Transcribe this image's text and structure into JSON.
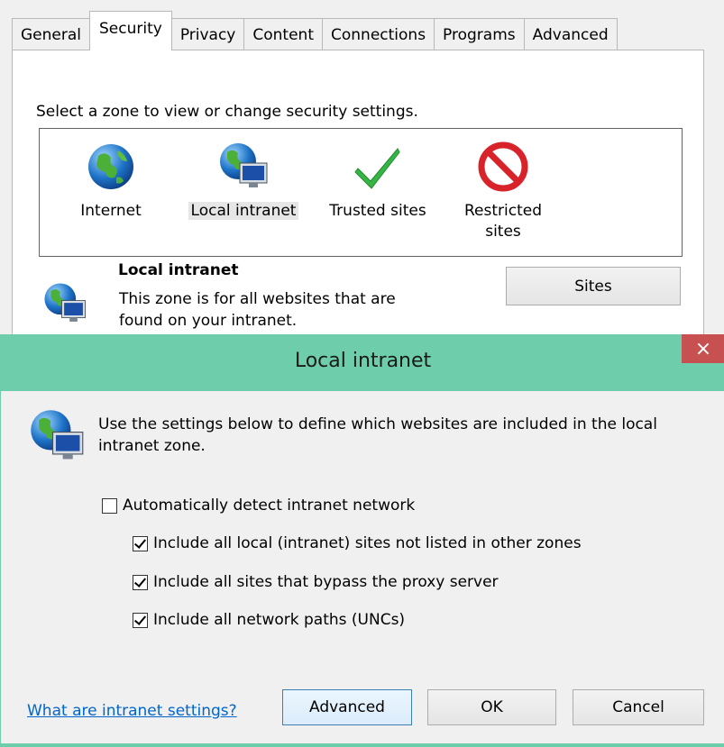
{
  "tabs": [
    "General",
    "Security",
    "Privacy",
    "Content",
    "Connections",
    "Programs",
    "Advanced"
  ],
  "security": {
    "caption": "Select a zone to view or change security settings.",
    "zones": [
      {
        "label": "Internet",
        "icon": "globe-icon"
      },
      {
        "label": "Local intranet",
        "icon": "intranet-icon"
      },
      {
        "label": "Trusted sites",
        "icon": "checkmark-icon"
      },
      {
        "label": "Restricted sites",
        "icon": "blocked-icon"
      }
    ],
    "selected_zone_title": "Local intranet",
    "selected_zone_description": "This zone is for all websites that are found on your intranet.",
    "sites_button": "Sites"
  },
  "dialog": {
    "title": "Local intranet",
    "close_glyph": "×",
    "intro": "Use the settings below to define which websites are included in the local intranet zone.",
    "options": [
      {
        "label": "Automatically detect intranet network",
        "checked": false
      },
      {
        "label": "Include all local (intranet) sites not listed in other zones",
        "checked": true
      },
      {
        "label": "Include all sites that bypass the proxy server",
        "checked": true
      },
      {
        "label": "Include all network paths (UNCs)",
        "checked": true
      }
    ],
    "help_link": "What are intranet settings?",
    "advanced_button": "Advanced",
    "ok_button": "OK",
    "cancel_button": "Cancel"
  },
  "colors": {
    "titlebar": "#6ecdab",
    "close": "#c75050",
    "link": "#0066cc"
  }
}
